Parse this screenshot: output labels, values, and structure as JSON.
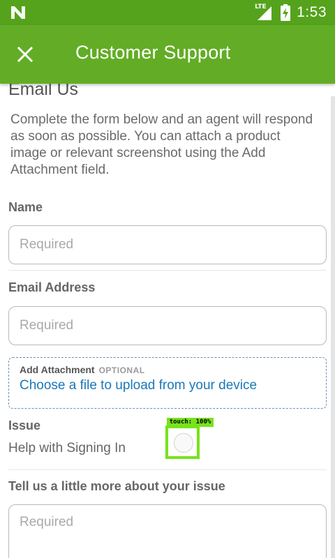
{
  "status_bar": {
    "network": "LTE",
    "time": "1:53"
  },
  "app_bar": {
    "title": "Customer Support"
  },
  "form": {
    "section_title": "Email Us",
    "intro": "Complete the form below and an agent will respond as soon as possible. You can attach a product image or relevant screenshot using the Add Attachment field.",
    "name": {
      "label": "Name",
      "placeholder": "Required",
      "value": ""
    },
    "email": {
      "label": "Email Address",
      "placeholder": "Required",
      "value": ""
    },
    "attachment": {
      "label": "Add Attachment",
      "optional": "OPTIONAL",
      "link": "Choose a file to upload from your device"
    },
    "issue": {
      "label": "Issue",
      "value": "Help with Signing In"
    },
    "details": {
      "label": "Tell us a little more about your issue",
      "placeholder": "Required"
    }
  },
  "touch_overlay": {
    "label": "touch: 100%"
  },
  "colors": {
    "status_bar": "#55a31c",
    "app_bar": "#62ad25",
    "link": "#1a78b8",
    "touch_marker": "#77e31c"
  }
}
